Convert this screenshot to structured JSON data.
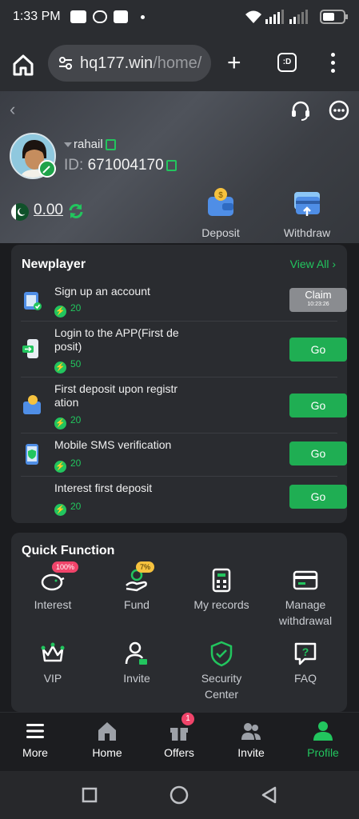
{
  "status_bar": {
    "time": "1:33 PM"
  },
  "browser": {
    "url_host": "hq177.win",
    "url_path": "/home/",
    "tabs_label": ":D"
  },
  "profile": {
    "username": "rahail",
    "id_label": "ID:",
    "id_value": "671004170",
    "balance": "0.00",
    "deposit_label": "Deposit",
    "withdraw_label": "Withdraw"
  },
  "newplayer": {
    "title": "Newplayer",
    "view_all": "View All",
    "tasks": [
      {
        "line1": "Sign up an account",
        "line2": "",
        "reward": "20",
        "button": "Claim",
        "timer": "10:23:26"
      },
      {
        "line1": "Login to the APP(First de",
        "line2": "posit)",
        "reward": "50",
        "button": "Go"
      },
      {
        "line1": "First deposit upon registr",
        "line2": "ation",
        "reward": "20",
        "button": "Go"
      },
      {
        "line1": "Mobile SMS verification",
        "line2": "",
        "reward": "20",
        "button": "Go"
      },
      {
        "line1": "Interest first deposit",
        "line2": "",
        "reward": "20",
        "button": "Go"
      }
    ]
  },
  "quick_function": {
    "title": "Quick Function",
    "items": [
      {
        "label1": "Interest",
        "label2": "",
        "badge": "100%"
      },
      {
        "label1": "Fund",
        "label2": "",
        "badge": "7%"
      },
      {
        "label1": "My records",
        "label2": ""
      },
      {
        "label1": "Manage",
        "label2": "withdrawal"
      },
      {
        "label1": "VIP",
        "label2": ""
      },
      {
        "label1": "Invite",
        "label2": ""
      },
      {
        "label1": "Security",
        "label2": "Center"
      },
      {
        "label1": "FAQ",
        "label2": ""
      }
    ]
  },
  "bottom_nav": [
    {
      "label": "More"
    },
    {
      "label": "Home"
    },
    {
      "label": "Offers",
      "badge": "1"
    },
    {
      "label": "Invite"
    },
    {
      "label": "Profile"
    }
  ],
  "colors": {
    "accent": "#22c55e",
    "badge": "#f0446a",
    "card": "#2a2c30",
    "background": "#1b1c1f"
  }
}
